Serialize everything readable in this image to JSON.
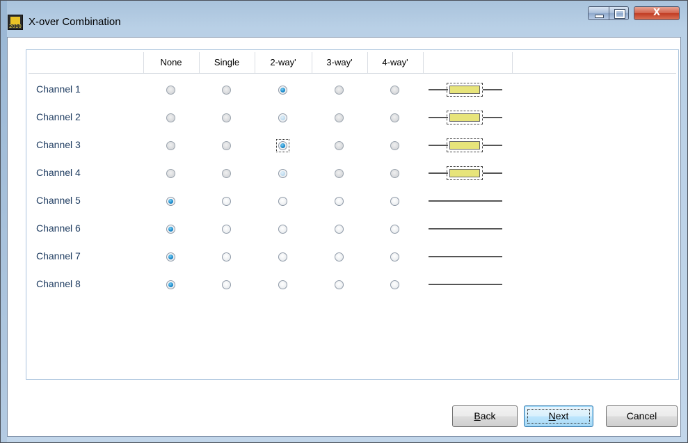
{
  "window": {
    "title": "X-over Combination",
    "icon_name": "app-logo-icon",
    "icon_text": "2010",
    "controls": {
      "minimize": "minimize-icon",
      "maximize": "maximize-icon",
      "close_glyph": "X"
    }
  },
  "table": {
    "columns": [
      "None",
      "Single",
      "2-way'",
      "3-way'",
      "4-way'",
      ""
    ],
    "rows": [
      {
        "label": "Channel 1",
        "selected": 2,
        "diagram": "xover"
      },
      {
        "label": "Channel 2",
        "selected": 2,
        "diagram": "xover"
      },
      {
        "label": "Channel 3",
        "selected": 2,
        "diagram": "xover"
      },
      {
        "label": "Channel 4",
        "selected": 2,
        "diagram": "xover"
      },
      {
        "label": "Channel 5",
        "selected": 0,
        "diagram": "line"
      },
      {
        "label": "Channel 6",
        "selected": 0,
        "diagram": "line"
      },
      {
        "label": "Channel 7",
        "selected": 0,
        "diagram": "line"
      },
      {
        "label": "Channel 8",
        "selected": 0,
        "diagram": "line"
      }
    ]
  },
  "buttons": {
    "back": {
      "mnemonic": "B",
      "rest": "ack"
    },
    "next": {
      "mnemonic": "N",
      "rest": "ext"
    },
    "cancel": "Cancel"
  },
  "colors": {
    "radio_selected": "#1c8ccc",
    "xover_fill": "#e7e47a",
    "title_bar": "#b9d0e6",
    "close_button": "#c13b22"
  }
}
